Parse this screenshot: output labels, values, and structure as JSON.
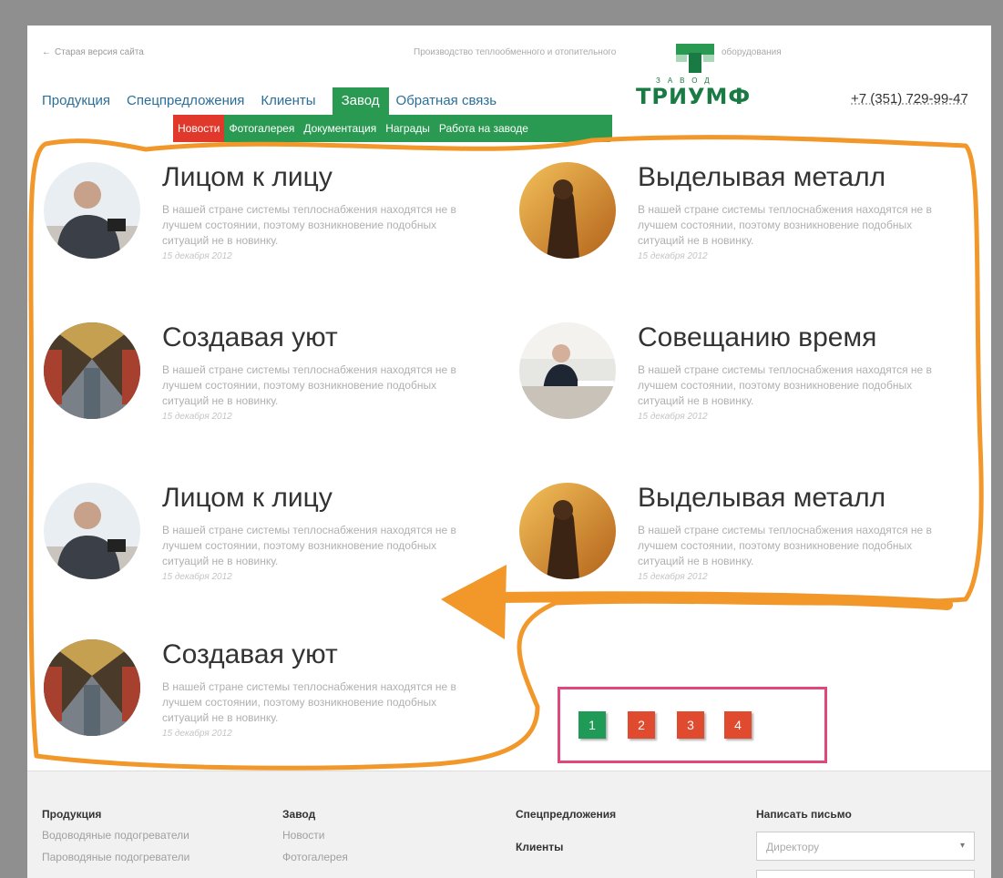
{
  "header": {
    "old_site_link": "Старая версия сайта",
    "tagline_left": "Производство теплообменного и отопительного",
    "tagline_right": "оборудования",
    "logo_small": "ЗАВОД",
    "logo_word": "ТРИУМФ",
    "phone": "+7 (351) 729-99-47"
  },
  "nav": {
    "items": [
      {
        "label": "Продукция"
      },
      {
        "label": "Спецпредложения"
      },
      {
        "label": "Клиенты"
      },
      {
        "label": "Завод"
      },
      {
        "label": "Обратная связь"
      }
    ],
    "active_index": 3
  },
  "subnav": {
    "items": [
      {
        "label": "Новости"
      },
      {
        "label": "Фотогалерея"
      },
      {
        "label": "Документация"
      },
      {
        "label": "Награды"
      },
      {
        "label": "Работа на заводе"
      }
    ]
  },
  "news": [
    {
      "title": "Лицом к лицу",
      "text": "В нашей стране системы теплоснабжения находятся не в лучшем состоянии, поэтому возникновение подобных ситуаций не в новинку.",
      "date": "15 декабря 2012",
      "image": "man-portrait"
    },
    {
      "title": "Выделывая металл",
      "text": "В нашей стране системы теплоснабжения находятся не в лучшем состоянии, поэтому возникновение подобных ситуаций не в новинку.",
      "date": "15 декабря 2012",
      "image": "metal-worker"
    },
    {
      "title": "Создавая уют",
      "text": "В нашей стране системы теплоснабжения находятся не в лучшем состоянии, поэтому возникновение подобных ситуаций не в новинку.",
      "date": "15 декабря 2012",
      "image": "factory-hall"
    },
    {
      "title": "Совещанию время",
      "text": "В нашей стране системы теплоснабжения находятся не в лучшем состоянии, поэтому возникновение подобных ситуаций не в новинку.",
      "date": "15 декабря 2012",
      "image": "meeting"
    },
    {
      "title": "Лицом к лицу",
      "text": "В нашей стране системы теплоснабжения находятся не в лучшем состоянии, поэтому возникновение подобных ситуаций не в новинку.",
      "date": "15 декабря 2012",
      "image": "man-portrait"
    },
    {
      "title": "Выделывая металл",
      "text": "В нашей стране системы теплоснабжения находятся не в лучшем состоянии, поэтому возникновение подобных ситуаций не в новинку.",
      "date": "15 декабря 2012",
      "image": "metal-worker"
    },
    {
      "title": "Создавая уют",
      "text": "В нашей стране системы теплоснабжения находятся не в лучшем состоянии, поэтому возникновение подобных ситуаций не в новинку.",
      "date": "15 декабря 2012",
      "image": "factory-hall"
    }
  ],
  "pagination": {
    "pages": [
      "1",
      "2",
      "3",
      "4"
    ],
    "current": "1"
  },
  "footer": {
    "col1_head": "Продукция",
    "col1_links": [
      "Водоводяные подогреватели",
      "Пароводяные подогреватели"
    ],
    "col2_head": "Завод",
    "col2_links": [
      "Новости",
      "Фотогалерея"
    ],
    "col3_head": "Спецпредложения",
    "col3_head2": "Клиенты",
    "col4_head": "Написать письмо",
    "select_value": "Директору"
  },
  "colors": {
    "brand_green": "#2a9a52",
    "accent_red": "#e0392b",
    "link_blue": "#2a6f9a",
    "annotation_orange": "#f2972a",
    "annotation_pink": "#e0477c"
  }
}
